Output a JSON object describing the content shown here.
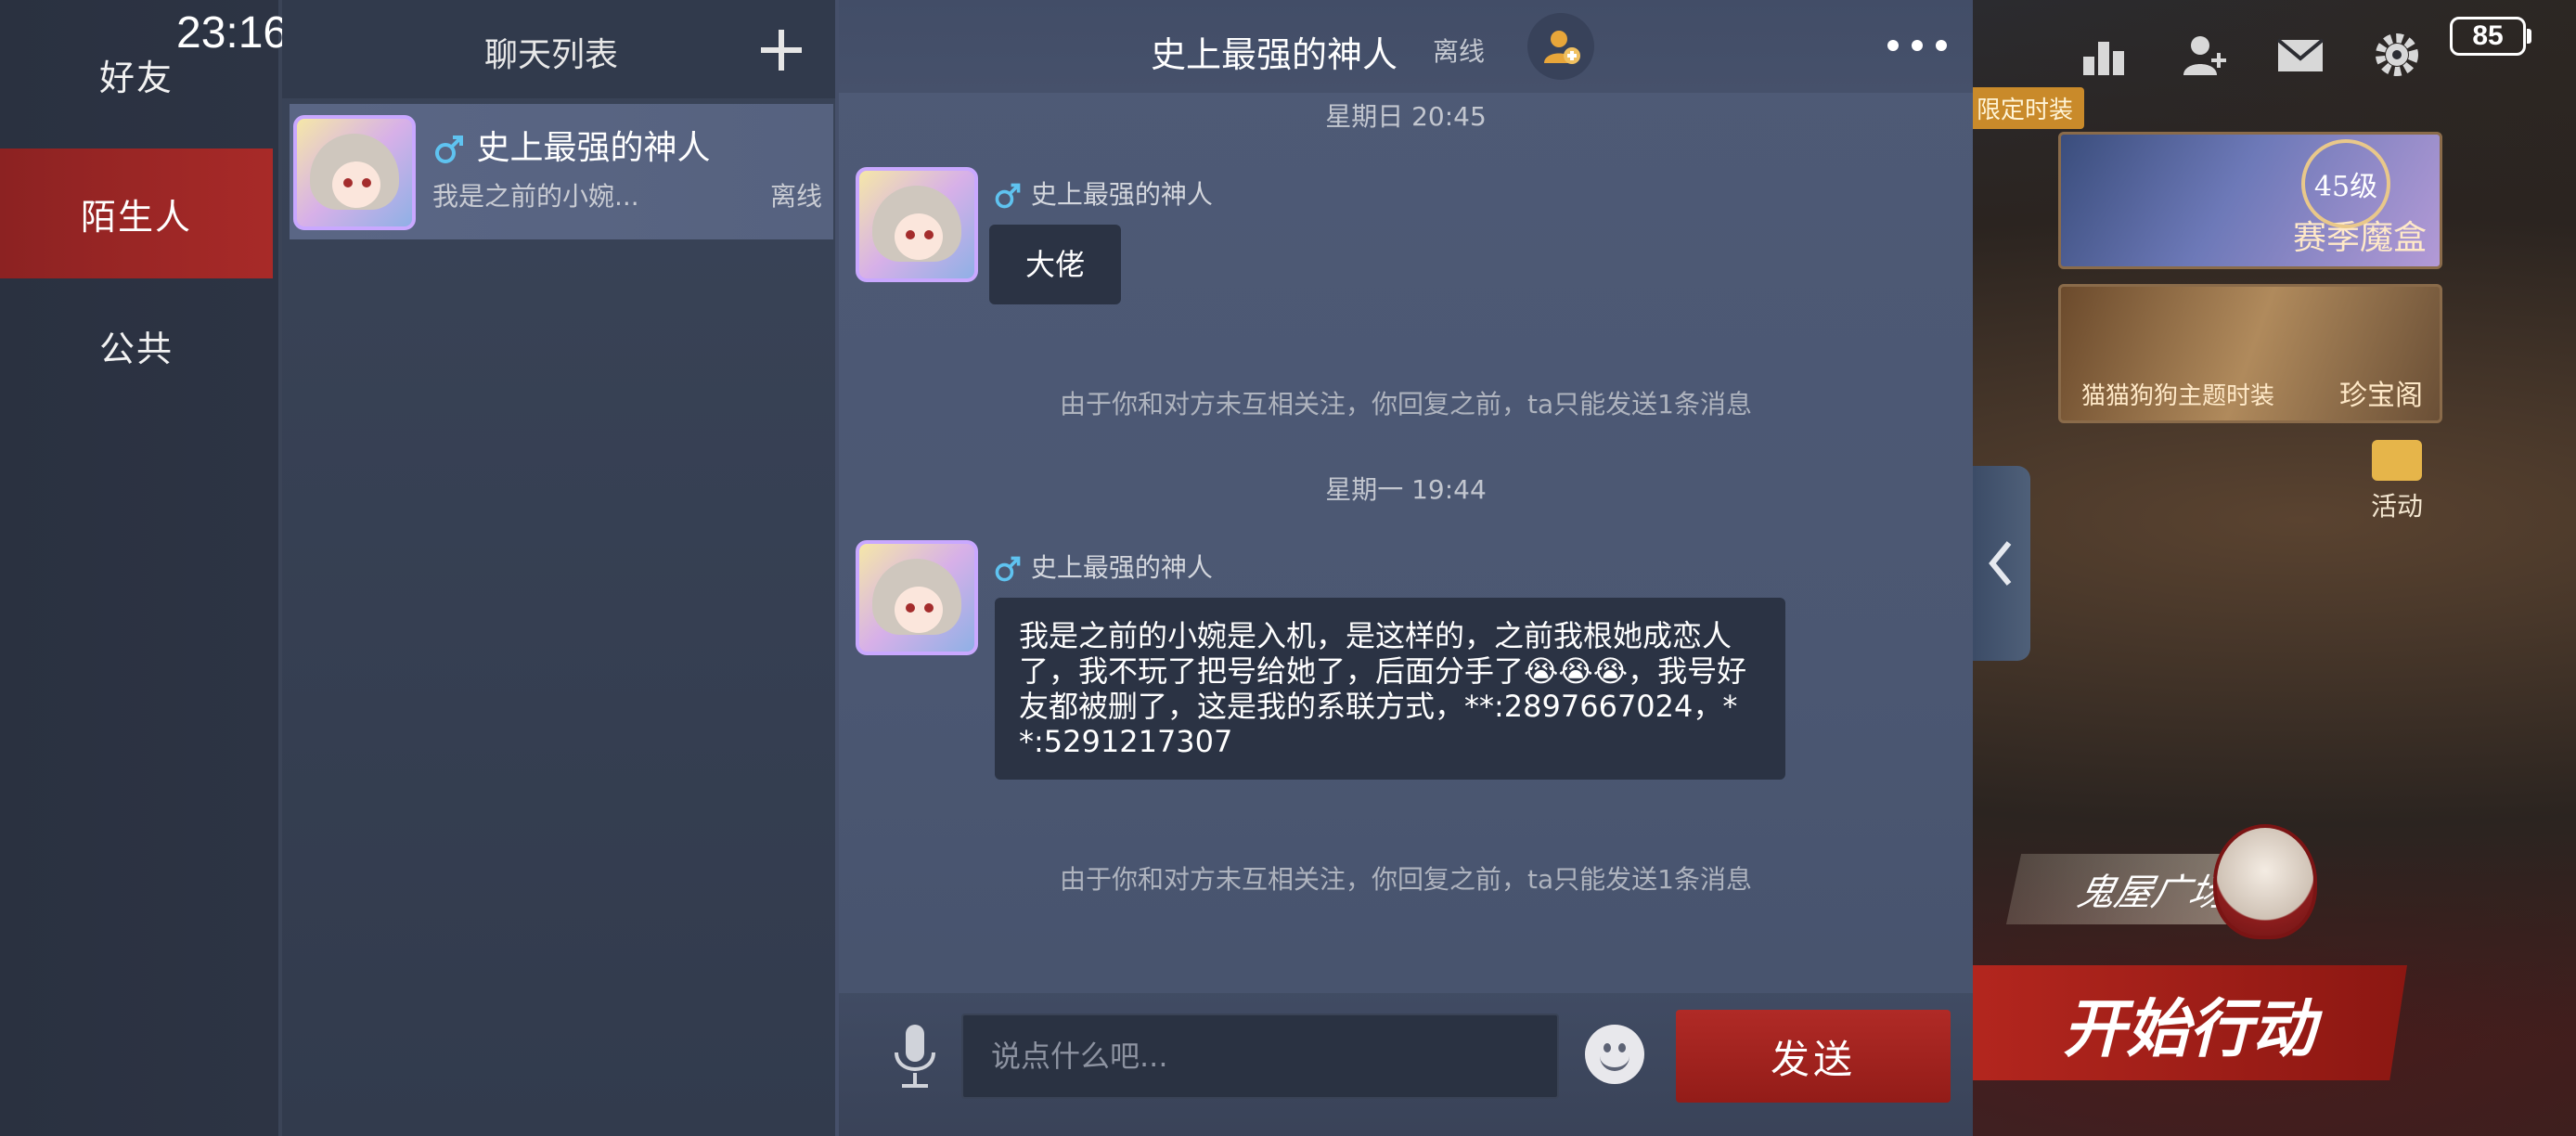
{
  "status_bar": {
    "time": "23:16",
    "battery": "85"
  },
  "nav": {
    "items": [
      {
        "label": "好友",
        "active": false
      },
      {
        "label": "陌生人",
        "active": true
      },
      {
        "label": "公共",
        "active": false
      }
    ]
  },
  "chat_list": {
    "title": "聊天列表",
    "items": [
      {
        "name": "史上最强的神人",
        "preview": "我是之前的小婉...",
        "status": "离线"
      }
    ]
  },
  "conversation": {
    "title": "史上最强的神人",
    "status": "离线",
    "messages": [
      {
        "timestamp": "星期日 20:45",
        "sender": "史上最强的神人",
        "text": "大佬",
        "note": "由于你和对方未互相关注，你回复之前，ta只能发送1条消息"
      },
      {
        "timestamp": "星期一 19:44",
        "sender": "史上最强的神人",
        "text": "我是之前的小婉是入机，是这样的，之前我根她成恋人了，我不玩了把号给她了，后面分手了😭😭😭，我号好友都被删了，这是我的系联方式，**:2897667024，**:5291217307",
        "note": "由于你和对方未互相关注，你回复之前，ta只能发送1条消息"
      }
    ]
  },
  "input": {
    "placeholder": "说点什么吧...",
    "send_label": "发送"
  },
  "game": {
    "limited_tag": "限定时装",
    "season_box": "赛季魔盒",
    "level": "45级",
    "theme_outfit": "猫猫狗狗主题时装",
    "treasure": "珍宝阁",
    "activity": "活动",
    "ghost_plaza": "鬼屋广场",
    "start_action": "开始行动"
  },
  "colors": {
    "active_nav": "#a82a28",
    "send_button": "#b02a26",
    "male_icon": "#5fc3f0"
  }
}
